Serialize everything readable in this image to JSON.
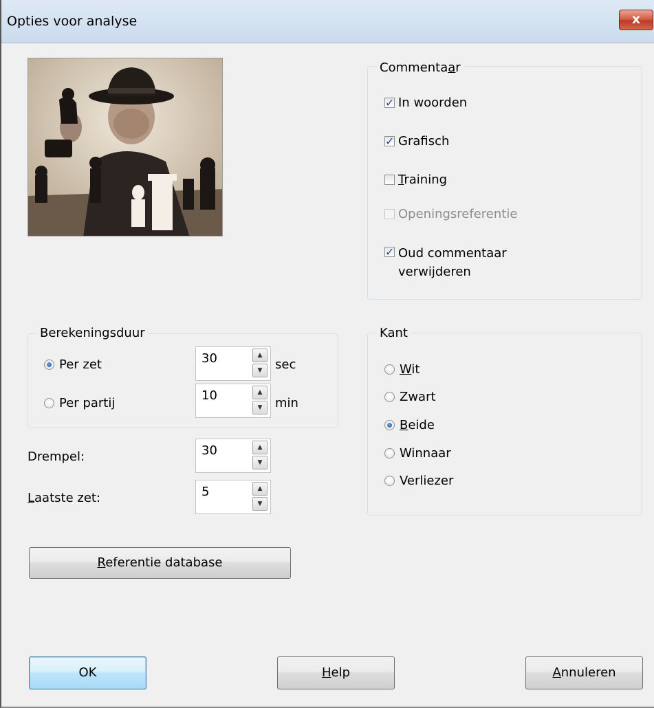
{
  "window": {
    "title": "Opties voor analyse",
    "close_label": "x"
  },
  "commentaar": {
    "legend_pre": "Commenta",
    "legend_u": "a",
    "legend_post": "r",
    "options": [
      {
        "label": "In woorden",
        "checked": true,
        "enabled": true
      },
      {
        "label": "Grafisch",
        "checked": true,
        "enabled": true
      },
      {
        "label_u": "T",
        "label_rest": "raining",
        "checked": false,
        "enabled": true
      },
      {
        "label": "Openingsreferentie",
        "checked": false,
        "enabled": false
      },
      {
        "label_line1": "Oud commentaar",
        "label_line2": "verwijderen",
        "checked": true,
        "enabled": true
      }
    ]
  },
  "berekeningsduur": {
    "legend": "Berekeningsduur",
    "per_zet": {
      "label": "Per zet",
      "value": "30",
      "unit": "sec",
      "selected": true
    },
    "per_partij": {
      "label": "Per partij",
      "value": "10",
      "unit": "min",
      "selected": false
    }
  },
  "drempel": {
    "label": "Drempel:",
    "value": "30"
  },
  "laatste_zet": {
    "label_u": "L",
    "label_rest": "aatste zet:",
    "value": "5"
  },
  "kant": {
    "legend": "Kant",
    "options": [
      {
        "u": "W",
        "rest": "it",
        "selected": false
      },
      {
        "u": "",
        "rest": "Zwart",
        "selected": false
      },
      {
        "u": "B",
        "rest": "eide",
        "selected": true
      },
      {
        "u": "",
        "rest": "Winnaar",
        "selected": false
      },
      {
        "u": "",
        "rest": "Verliezer",
        "selected": false
      }
    ]
  },
  "buttons": {
    "referentie_u": "R",
    "referentie_rest": "eferentie database",
    "ok": "OK",
    "help_u": "H",
    "help_rest": "elp",
    "annuleren_u": "A",
    "annuleren_rest": "nnuleren"
  },
  "icons": {
    "close": "close-icon",
    "spin_up": "spin-up-icon",
    "spin_down": "spin-down-icon"
  }
}
